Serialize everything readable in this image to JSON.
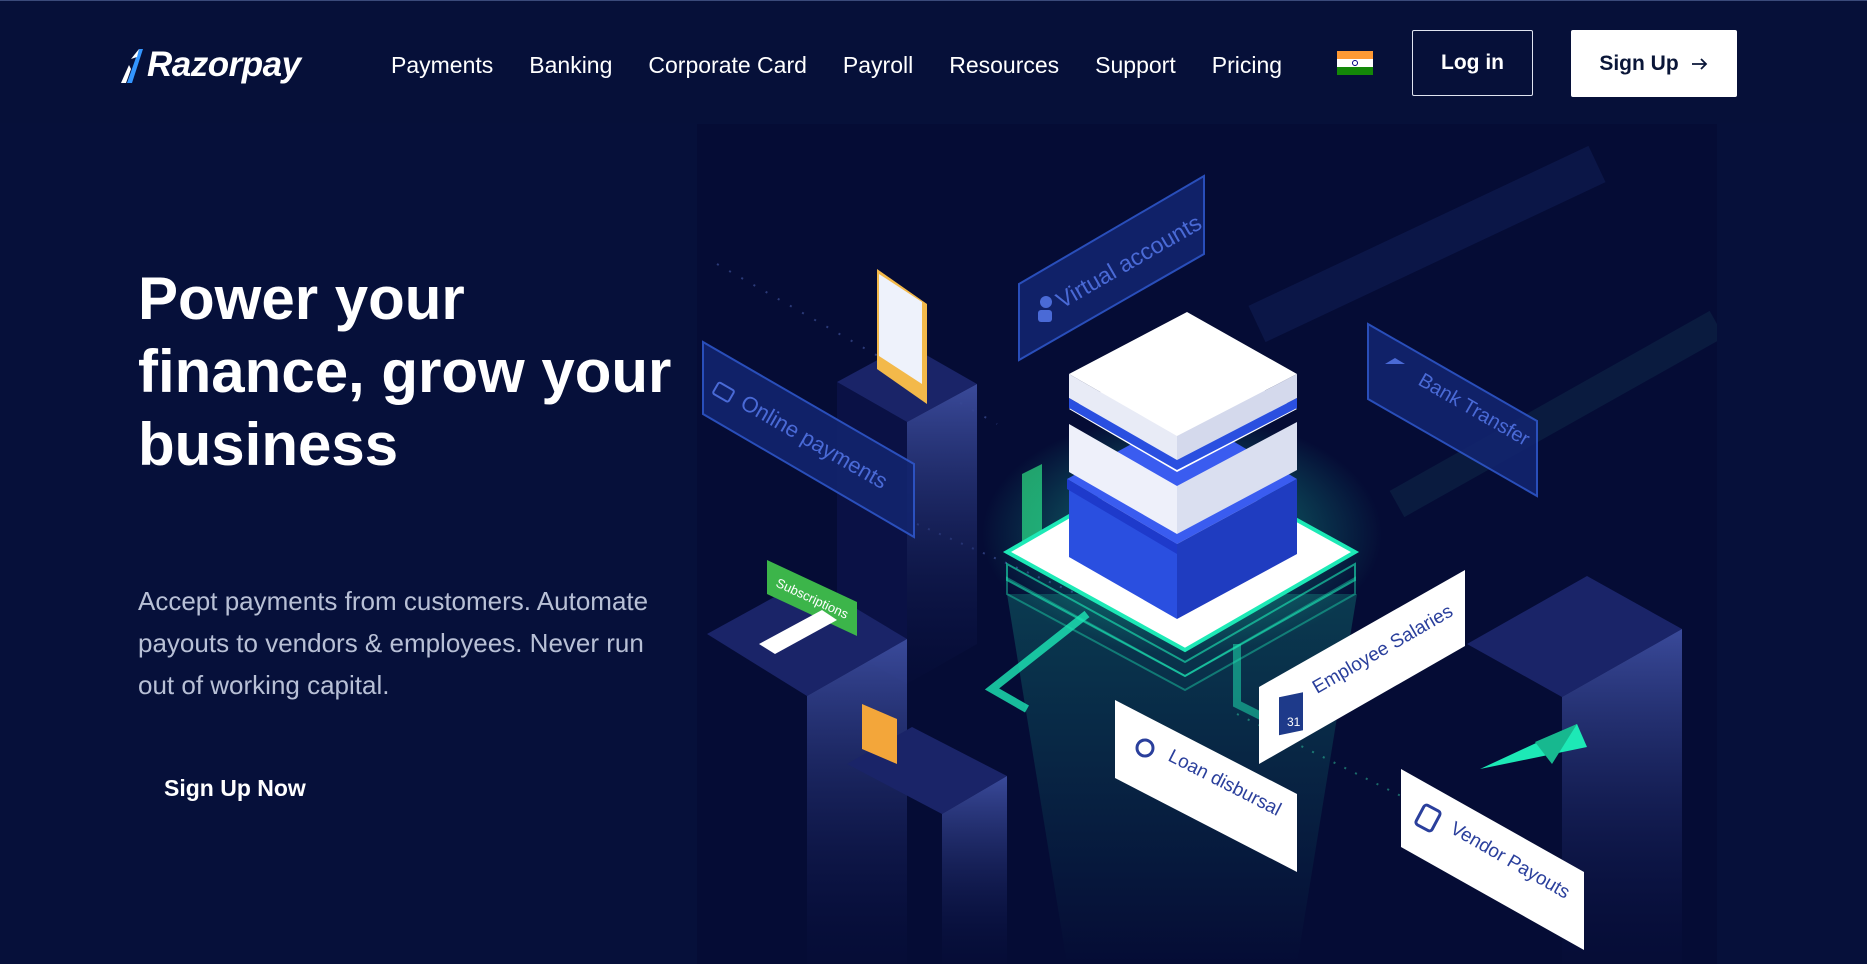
{
  "brand": {
    "name": "Razorpay"
  },
  "nav": {
    "items": [
      "Payments",
      "Banking",
      "Corporate Card",
      "Payroll",
      "Resources",
      "Support",
      "Pricing"
    ],
    "country_flag": "flag-icon-india",
    "login_label": "Log in",
    "signup_label": "Sign Up"
  },
  "hero": {
    "title": "Power your finance, grow your business",
    "subtitle": "Accept payments from customers. Automate payouts to vendors & employees. Never run out of working capital.",
    "cta_label": "Sign Up Now"
  },
  "illustration": {
    "labels": {
      "virtual_accounts": "Virtual accounts",
      "online_payments": "Online payments",
      "bank_transfer": "Bank Transfer",
      "subscriptions": "Subscriptions",
      "employee_salaries": "Employee Salaries",
      "loan_disbursal": "Loan disbursal",
      "vendor_payouts": "Vendor Payouts",
      "calendar_day": "31"
    }
  },
  "colors": {
    "background": "#06103a",
    "accent_blue": "#3395ff",
    "glow_green": "#1de9b6",
    "panel_blue": "#1d3a8c"
  }
}
